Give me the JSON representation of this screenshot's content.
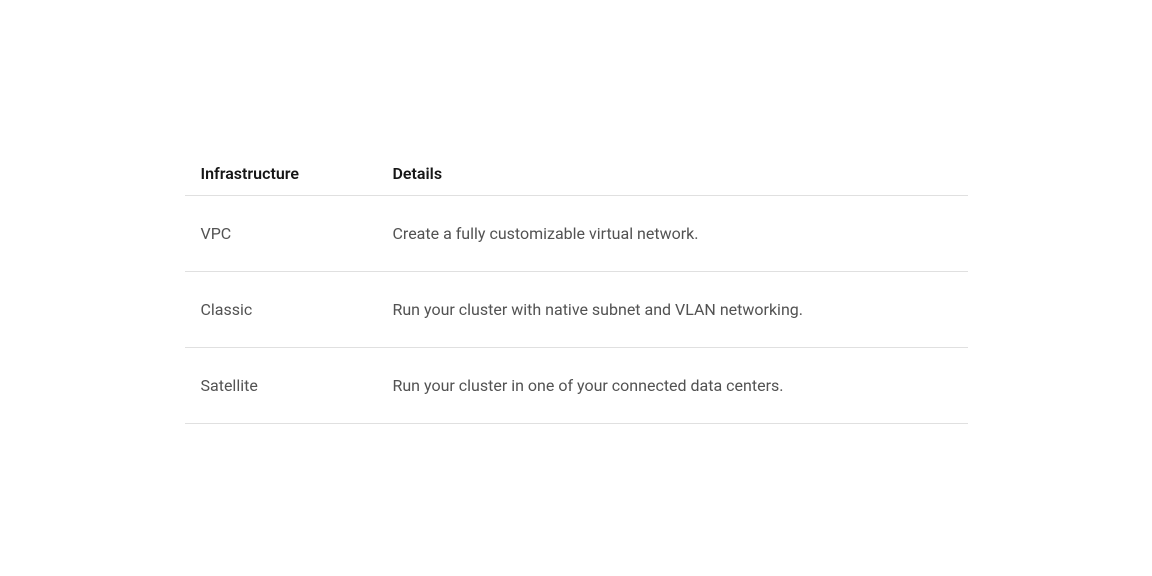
{
  "table": {
    "headers": {
      "infrastructure": "Infrastructure",
      "details": "Details"
    },
    "rows": [
      {
        "infrastructure": "VPC",
        "details": "Create a fully customizable virtual network."
      },
      {
        "infrastructure": "Classic",
        "details": "Run your cluster with native subnet and VLAN networking."
      },
      {
        "infrastructure": "Satellite",
        "details": "Run your cluster in one of your connected data centers."
      }
    ]
  }
}
